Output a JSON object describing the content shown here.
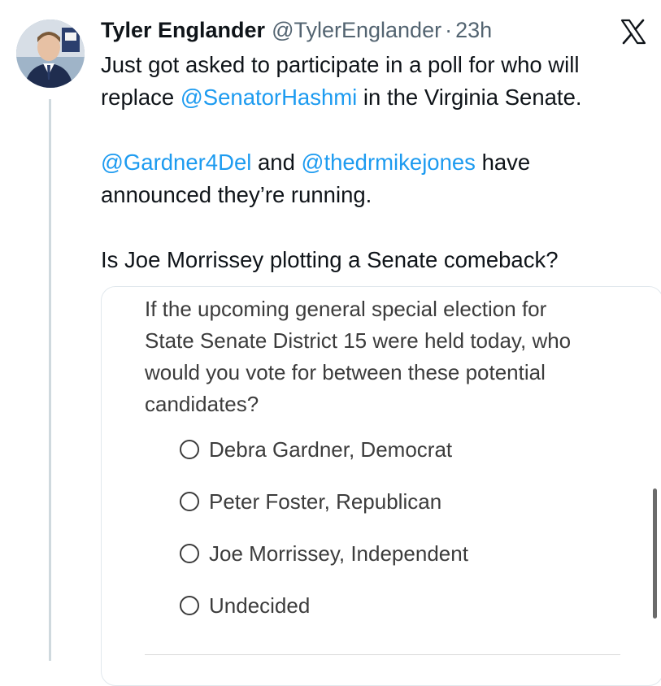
{
  "tweet": {
    "author_name": "Tyler Englander",
    "handle": "@TylerEnglander",
    "separator": "·",
    "time": "23h",
    "lines": [
      [
        {
          "t": "Just got asked to participate in a poll for who will"
        }
      ],
      [
        {
          "t": "replace "
        },
        {
          "t": "@SenatorHashmi",
          "mention": true
        },
        {
          "t": " in the Virginia Senate."
        }
      ],
      [],
      [
        {
          "t": "@Gardner4Del",
          "mention": true
        },
        {
          "t": " and "
        },
        {
          "t": "@thedrmikejones",
          "mention": true
        },
        {
          "t": " have"
        }
      ],
      [
        {
          "t": "announced they’re running."
        }
      ],
      [],
      [
        {
          "t": "Is Joe Morrissey plotting a Senate comeback?"
        }
      ]
    ]
  },
  "poll": {
    "question_lines": [
      "If the upcoming general special election for",
      "State Senate District 15 were held today, who",
      "would you vote for between these potential",
      "candidates?"
    ],
    "options": [
      "Debra Gardner, Democrat",
      "Peter Foster, Republican",
      "Joe Morrissey, Independent",
      "Undecided"
    ]
  },
  "icons": {
    "brand": "x-logo-icon",
    "option_marker": "radio-unchecked-icon"
  },
  "colors": {
    "mention": "#1d9bf0",
    "text": "#0f1419",
    "muted": "#536471",
    "poll_text": "#3c3c3c"
  }
}
